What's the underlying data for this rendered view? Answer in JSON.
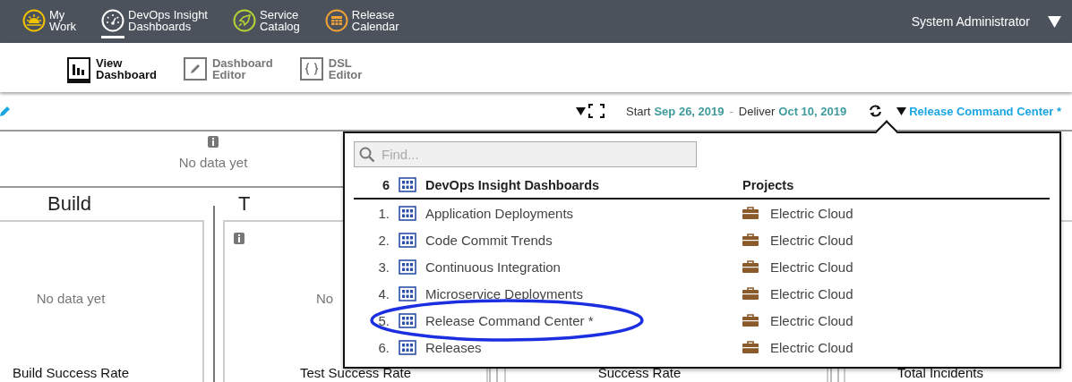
{
  "top_nav": {
    "items": [
      {
        "label": "My\nWork",
        "kind": "sun",
        "color": "#f2c200",
        "selected": false
      },
      {
        "label": "DevOps Insight\nDashboards",
        "kind": "gauge",
        "color": "#ffffff",
        "selected": true
      },
      {
        "label": "Service\nCatalog",
        "kind": "rocket",
        "color": "#b5d334",
        "selected": false
      },
      {
        "label": "Release\nCalendar",
        "kind": "calendar",
        "color": "#f0a136",
        "selected": false
      }
    ],
    "user": "System Administrator"
  },
  "sub_nav": {
    "tabs": [
      {
        "label": "View\nDashboard",
        "kind": "chart",
        "selected": true
      },
      {
        "label": "Dashboard\nEditor",
        "kind": "pencil",
        "selected": false
      },
      {
        "label": "DSL\nEditor",
        "kind": "braces",
        "selected": false
      }
    ]
  },
  "toolbar": {
    "start_label": "Start",
    "start_date": "Sep 26, 2019",
    "separator": "-",
    "deliver_label": "Deliver",
    "deliver_date": "Oct 10, 2019",
    "dashboard_menu": "Release Command Center *"
  },
  "dashboard": {
    "top_panel": {
      "message": "No data yet"
    },
    "sections": [
      {
        "title": "Build"
      },
      {
        "title": "T"
      }
    ],
    "cards": [
      {
        "info": false,
        "message": "No data yet",
        "title": "Build Success Rate"
      },
      {
        "info": true,
        "message": "No",
        "title": "Test Success Rate"
      },
      {
        "title": "Success Rate"
      },
      {
        "title": "Total Incidents"
      }
    ]
  },
  "dashboard_picker": {
    "search": {
      "placeholder": "Find..."
    },
    "count": "6",
    "column_name": "DevOps Insight Dashboards",
    "column_project": "Projects",
    "rows": [
      {
        "number": "1.",
        "name": "Application Deployments",
        "project": "Electric Cloud",
        "circled": false
      },
      {
        "number": "2.",
        "name": "Code Commit Trends",
        "project": "Electric Cloud",
        "circled": false
      },
      {
        "number": "3.",
        "name": "Continuous Integration",
        "project": "Electric Cloud",
        "circled": false
      },
      {
        "number": "4.",
        "name": "Microservice Deployments",
        "project": "Electric Cloud",
        "circled": false
      },
      {
        "number": "5.",
        "name": "Release Command Center *",
        "project": "Electric Cloud",
        "circled": true
      },
      {
        "number": "6.",
        "name": "Releases",
        "project": "Electric Cloud",
        "circled": false
      }
    ]
  }
}
